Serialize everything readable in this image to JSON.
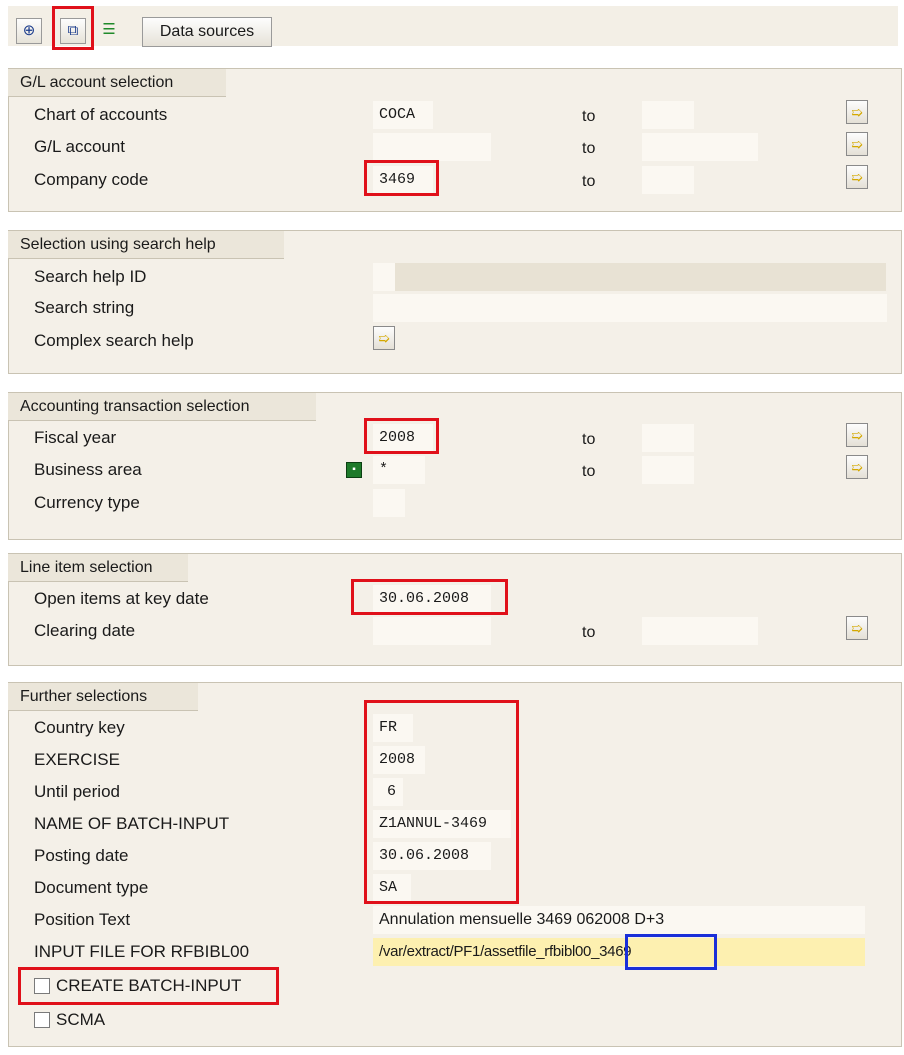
{
  "toolbar": {
    "execute_icon": "execute-icon",
    "copy_icon": "copy-icon",
    "dynamic_selection_icon": "dynamic-selection-icon",
    "data_sources_label": "Data sources"
  },
  "gl_account_selection": {
    "title": "G/L account selection",
    "chart_of_accounts_label": "Chart of accounts",
    "chart_of_accounts_from": "COCA",
    "gl_account_label": "G/L account",
    "company_code_label": "Company code",
    "company_code_from": "3469",
    "to_label": "to"
  },
  "search_help": {
    "title": "Selection using search help",
    "search_help_id_label": "Search help ID",
    "search_string_label": "Search string",
    "complex_search_help_label": "Complex search help"
  },
  "accounting_transaction": {
    "title": "Accounting transaction selection",
    "fiscal_year_label": "Fiscal year",
    "fiscal_year_from": "2008",
    "business_area_label": "Business area",
    "business_area_from": "*",
    "currency_type_label": "Currency type",
    "to_label": "to"
  },
  "line_item": {
    "title": "Line item selection",
    "open_items_label": "Open items at key date",
    "open_items_value": "30.06.2008",
    "clearing_date_label": "Clearing date",
    "to_label": "to"
  },
  "further": {
    "title": "Further selections",
    "country_key_label": "Country key",
    "country_key_value": "FR",
    "exercise_label": "EXERCISE",
    "exercise_value": "2008",
    "until_period_label": "Until period",
    "until_period_value": "6",
    "batch_input_name_label": "NAME OF BATCH-INPUT",
    "batch_input_name_value": "Z1ANNUL-3469",
    "posting_date_label": "Posting date",
    "posting_date_value": "30.06.2008",
    "document_type_label": "Document type",
    "document_type_value": "SA",
    "position_text_label": "Position Text",
    "position_text_value": "Annulation mensuelle 3469 062008 D+3",
    "input_file_label": "INPUT FILE FOR RFBIBL00",
    "input_file_value": "/var/extract/PF1/assetfile_rfbibl00_3469",
    "create_batch_input_label": "CREATE BATCH-INPUT",
    "create_batch_input_checked": false,
    "scma_label": "SCMA",
    "scma_checked": false
  },
  "colors": {
    "highlight_red": "#e0101a",
    "highlight_blue": "#1a2fd8",
    "group_bg": "#f4f0e8",
    "file_field_bg": "#fdf0b0"
  }
}
